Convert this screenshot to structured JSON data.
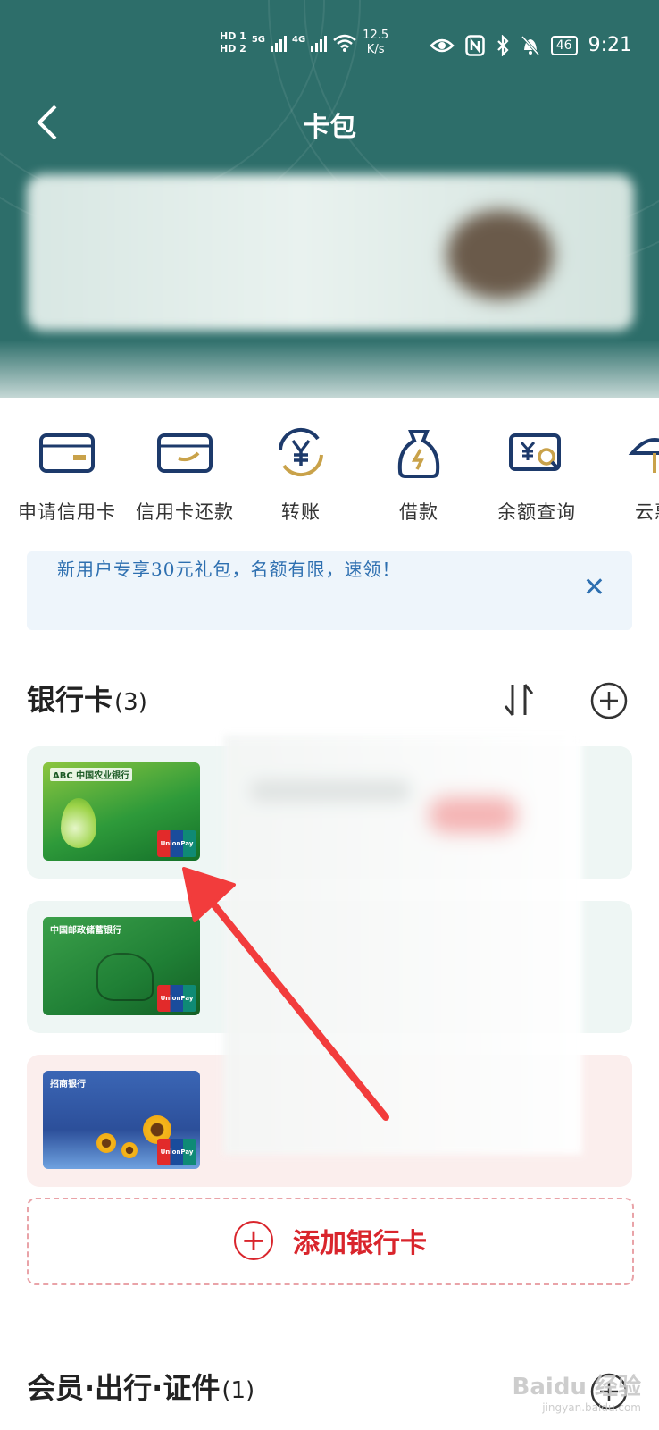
{
  "status_bar": {
    "hd1": "HD 1",
    "hd2": "HD 2",
    "net1": "5G",
    "net2": "4G",
    "speed_value": "12.5",
    "speed_unit": "K/s",
    "battery": "46",
    "time": "9:21",
    "icons": [
      "eye-icon",
      "nfc-icon",
      "bluetooth-icon",
      "mute-icon"
    ]
  },
  "header": {
    "back": "‹",
    "title": "卡包"
  },
  "quick_actions": [
    {
      "label": "申请信用卡",
      "icon": "card-apply-icon"
    },
    {
      "label": "信用卡还款",
      "icon": "card-repay-icon"
    },
    {
      "label": "转账",
      "icon": "transfer-icon"
    },
    {
      "label": "借款",
      "icon": "loan-icon"
    },
    {
      "label": "余额查询",
      "icon": "balance-query-icon"
    },
    {
      "label": "云惠",
      "icon": "cloud-icon"
    }
  ],
  "notice": {
    "text": "新用户专享30元礼包，名额有限，速领！",
    "close": "✕"
  },
  "bank_section": {
    "title": "银行卡",
    "count": "(3)",
    "cards": [
      {
        "bank": "ABC 中国农业银行",
        "style": "abc",
        "union_label": "UnionPay 银联"
      },
      {
        "bank": "中国邮政储蓄银行",
        "style": "psbc",
        "union_label": "UnionPay 银联"
      },
      {
        "bank": "招商银行",
        "style": "cmb",
        "union_label": "UnionPay 银联"
      }
    ]
  },
  "add_bank_card": {
    "plus": "+",
    "label": "添加银行卡"
  },
  "member_section": {
    "title": "会员·出行·证件",
    "count": "(1)"
  },
  "watermark": {
    "text": "Baidu 经验",
    "sub": "jingyan.baidu.com"
  },
  "colors": {
    "header_bg": "#2d6e6a",
    "icon_navy": "#1d3a6b",
    "icon_gold": "#c9a24a",
    "notice_blue": "#2d6fb0",
    "accent_red": "#d9252c",
    "arrow_red": "#f23c3c"
  }
}
